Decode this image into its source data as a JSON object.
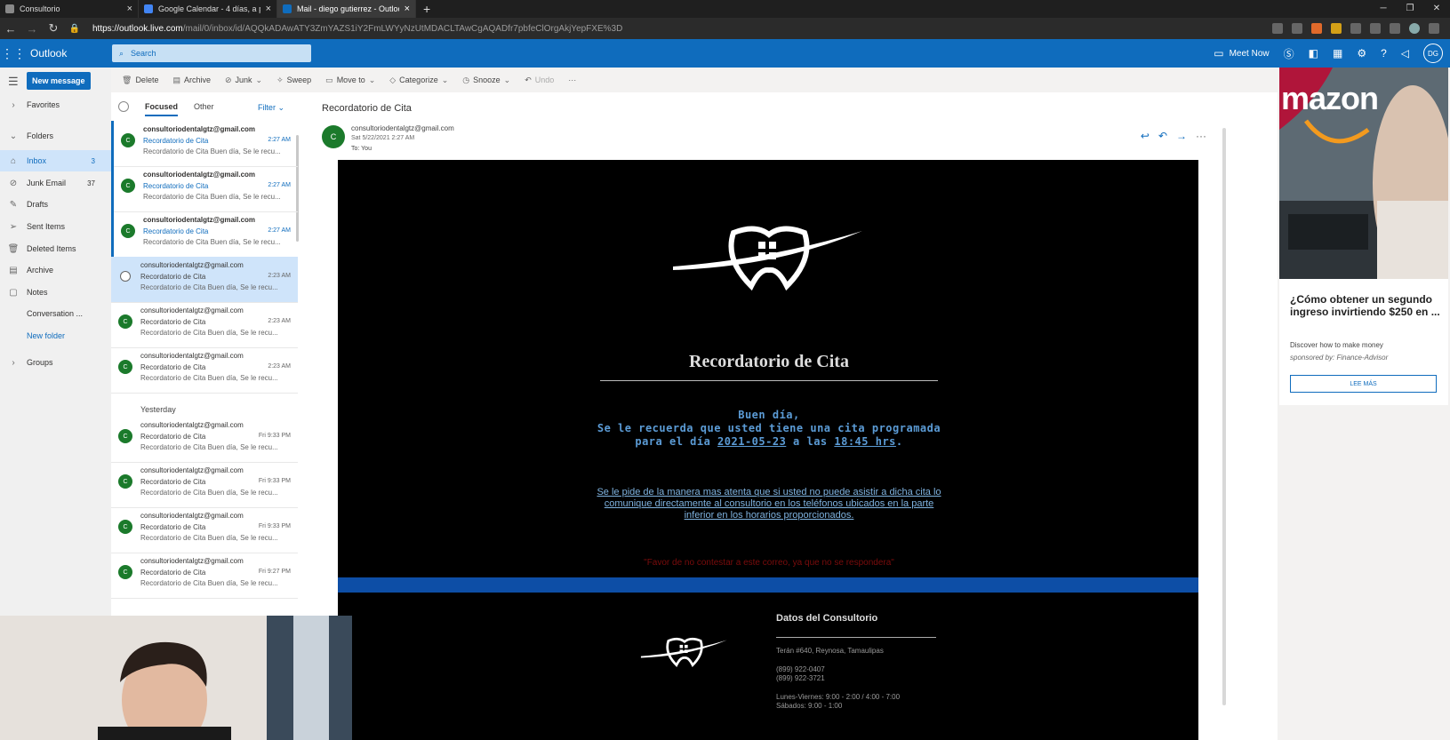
{
  "browser": {
    "tabs": [
      {
        "title": "Consultorio"
      },
      {
        "title": "Google Calendar - 4 días, a partir..."
      },
      {
        "title": "Mail - diego gutierrez - Outlook"
      }
    ],
    "url": {
      "host": "https://outlook.live.com",
      "path": "/mail/0/inbox/id/AQQkADAwATY3ZmYAZS1iY2FmLWYyNzUtMDACLTAwCgAQADfr7pbfeClOrgAkjYepFXE%3D"
    }
  },
  "outlook": {
    "app_name": "Outlook",
    "search_placeholder": "Search",
    "meet_now": "Meet Now",
    "user_initials": "DG"
  },
  "nav": {
    "new_message": "New message",
    "items": [
      {
        "label": "Favorites",
        "count": ""
      },
      {
        "label": "Folders",
        "count": ""
      },
      {
        "label": "Inbox",
        "count": "3"
      },
      {
        "label": "Junk Email",
        "count": "37"
      },
      {
        "label": "Drafts",
        "count": ""
      },
      {
        "label": "Sent Items",
        "count": ""
      },
      {
        "label": "Deleted Items",
        "count": ""
      },
      {
        "label": "Archive",
        "count": ""
      },
      {
        "label": "Notes",
        "count": ""
      },
      {
        "label": "Conversation ...",
        "count": ""
      },
      {
        "label": "New folder",
        "count": ""
      },
      {
        "label": "Groups",
        "count": ""
      }
    ]
  },
  "commands": [
    "Delete",
    "Archive",
    "Junk",
    "Sweep",
    "Move to",
    "Categorize",
    "Snooze",
    "Undo"
  ],
  "list": {
    "pivots": [
      "Focused",
      "Other"
    ],
    "filter": "Filter",
    "yesterday": "Yesterday",
    "messages": [
      {
        "from": "consultoriodentalgtz@gmail.com",
        "subject": "Recordatorio de Cita",
        "time": "2:27 AM",
        "preview": "Recordatorio de Cita Buen día, Se le recu..."
      },
      {
        "from": "consultoriodentalgtz@gmail.com",
        "subject": "Recordatorio de Cita",
        "time": "2:27 AM",
        "preview": "Recordatorio de Cita Buen día, Se le recu..."
      },
      {
        "from": "consultoriodentalgtz@gmail.com",
        "subject": "Recordatorio de Cita",
        "time": "2:27 AM",
        "preview": "Recordatorio de Cita Buen día, Se le recu..."
      },
      {
        "from": "consultoriodentalgtz@gmail.com",
        "subject": "Recordatorio de Cita",
        "time": "2:23 AM",
        "preview": "Recordatorio de Cita Buen día, Se le recu..."
      },
      {
        "from": "consultoriodentalgtz@gmail.com",
        "subject": "Recordatorio de Cita",
        "time": "2:23 AM",
        "preview": "Recordatorio de Cita Buen día, Se le recu..."
      },
      {
        "from": "consultoriodentalgtz@gmail.com",
        "subject": "Recordatorio de Cita",
        "time": "2:23 AM",
        "preview": "Recordatorio de Cita Buen día, Se le recu..."
      },
      {
        "from": "consultoriodentalgtz@gmail.com",
        "subject": "Recordatorio de Cita",
        "time": "Fri 9:33 PM",
        "preview": "Recordatorio de Cita Buen día, Se le recu..."
      },
      {
        "from": "consultoriodentalgtz@gmail.com",
        "subject": "Recordatorio de Cita",
        "time": "Fri 9:33 PM",
        "preview": "Recordatorio de Cita Buen día, Se le recu..."
      },
      {
        "from": "consultoriodentalgtz@gmail.com",
        "subject": "Recordatorio de Cita",
        "time": "Fri 9:33 PM",
        "preview": "Recordatorio de Cita Buen día, Se le recu..."
      },
      {
        "from": "consultoriodentalgtz@gmail.com",
        "subject": "Recordatorio de Cita",
        "time": "Fri 9:27 PM",
        "preview": "Recordatorio de Cita Buen día, Se le recu..."
      }
    ]
  },
  "reading": {
    "subject": "Recordatorio de Cita",
    "avatar": "C",
    "sender": "consultoriodentalgtz@gmail.com",
    "date": "Sat 5/22/2021 2:27 AM",
    "to": "To: You"
  },
  "email": {
    "title": "Recordatorio de Cita",
    "greeting": "Buen día,",
    "line1": "Se le recuerda que usted tiene una cita programada",
    "line2_pre": "para el día ",
    "date": "2021-05-23",
    "line2_mid": " a las ",
    "time": "18:45 hrs",
    "line2_post": ".",
    "request": "Se le pide de la manera mas atenta que si usted no puede asistir a dicha cita lo comunique directamente al consultorio en los teléfonos ubicados en la parte inferior en los horarios proporcionados.",
    "noreply": "\"Favor de no contestar a este correo, ya que no se respondera\"",
    "datos_title": "Datos del Consultorio",
    "address": "Terán #640, Reynosa, Tamaulipas",
    "phone1": "(899) 922-0407",
    "phone2": "(899) 922-3721",
    "hours1": "Lunes-Viernes: 9:00 - 2:00 / 4:00 - 7:00",
    "hours2": "Sábados: 9:00 - 1:00"
  },
  "ad": {
    "brand_text": "mazon",
    "title": "¿Cómo obtener un segundo ingreso invirtiendo $250 en ...",
    "subtitle": "Discover how to make money",
    "sponsor": "sponsored by: Finance-Advisor",
    "cta": "LEE MÁS"
  },
  "colors": {
    "outlook_blue": "#0f6cbd",
    "email_band": "#0d4ea6",
    "avatar_green": "#1b7a2b"
  }
}
